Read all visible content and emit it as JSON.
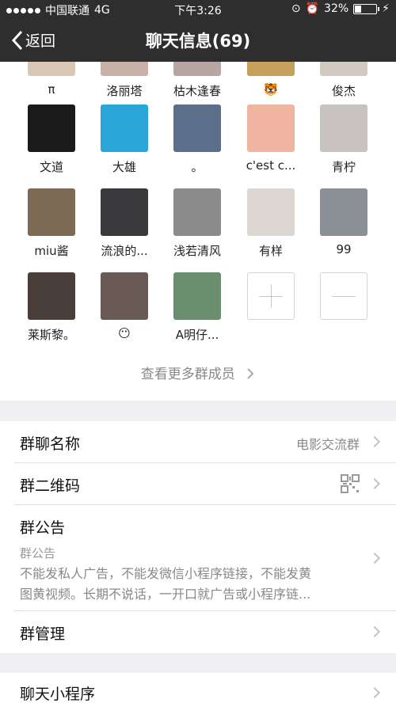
{
  "status_bar": {
    "carrier": "中国联通",
    "network": "4G",
    "time": "下午3:26",
    "battery": "32%",
    "battery_level": 0.32
  },
  "nav": {
    "back_label": "返回",
    "title": "聊天信息(69)"
  },
  "members": [
    {
      "name": "π",
      "color": "#d9c7b5"
    },
    {
      "name": "洛丽塔",
      "color": "#c9b0a8"
    },
    {
      "name": "枯木逢春",
      "color": "#b7a6a2"
    },
    {
      "name": "🐯",
      "color": "#c4a05a"
    },
    {
      "name": "俊杰",
      "color": "#d2c9c0"
    },
    {
      "name": "文道",
      "color": "#1b1b1b"
    },
    {
      "name": "大雄",
      "color": "#2aa6d8"
    },
    {
      "name": "。",
      "color": "#5b6f8a"
    },
    {
      "name": "c'est c...",
      "color": "#f0b5a0"
    },
    {
      "name": "青柠",
      "color": "#c8c3c0"
    },
    {
      "name": "miu酱",
      "color": "#7d6a55"
    },
    {
      "name": "流浪的...",
      "color": "#3a3a3c"
    },
    {
      "name": "浅若清风",
      "color": "#8c8c8c"
    },
    {
      "name": "有样",
      "color": "#dcd6d0"
    },
    {
      "name": "99",
      "color": "#8b8f96"
    },
    {
      "name": "莱斯黎。",
      "color": "#4a3e3a"
    },
    {
      "name": "😶",
      "color": "#6a5a55"
    },
    {
      "name": "A明仔...",
      "color": "#6b8f6e"
    }
  ],
  "more_members": "查看更多群成员",
  "settings": {
    "group_name_label": "群聊名称",
    "group_name_value": "电影交流群",
    "qr_label": "群二维码",
    "notice_label": "群公告",
    "notice_subtitle": "群公告",
    "notice_line1": "不能发私人广告，不能发微信小程序链接，不能发黄",
    "notice_line2": "图黄视频。长期不说话，一开口就广告或小程序链...",
    "manage_label": "群管理",
    "mini_program_label": "聊天小程序"
  }
}
